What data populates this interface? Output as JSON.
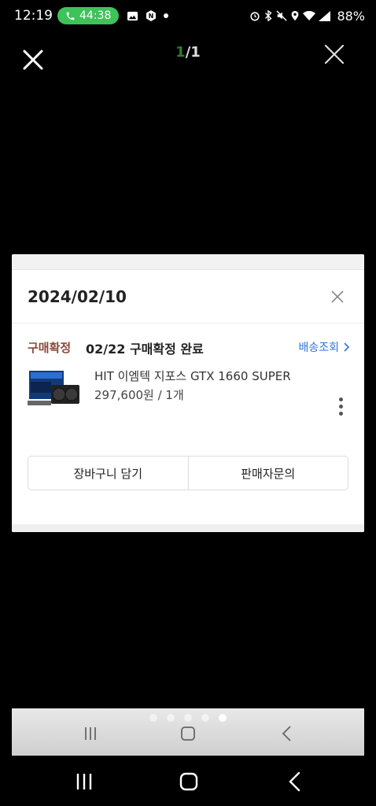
{
  "status_bar": {
    "time": "12:19",
    "call_timer": "44:38",
    "battery": "88%"
  },
  "viewer": {
    "page_current": "1",
    "page_total": "/1"
  },
  "order": {
    "date": "2024/02/10",
    "status_tag": "구매확정",
    "status_text": "02/22 구매확정 완료",
    "tracking_label": "배송조회",
    "product_name": "HIT 이엠텍 지포스 GTX 1660 SUPER",
    "product_price_qty": "297,600원 / 1개",
    "add_to_cart_label": "장바구니 담기",
    "seller_inquiry_label": "판매자문의"
  },
  "icons": {
    "viewer_close_left": "close-icon",
    "viewer_close_right": "close-icon",
    "card_close": "close-icon",
    "tracking_arrow": "chevron-right-icon",
    "more": "more-vertical-icon",
    "recents": "recents-icon",
    "home": "home-icon",
    "back": "back-icon"
  },
  "colors": {
    "call_pill": "#3ec25a",
    "page_current": "#2e7d32",
    "status_tag": "#8a4a3a",
    "link": "#2f73d8"
  },
  "pager": {
    "total": 5,
    "active_index": 4
  }
}
